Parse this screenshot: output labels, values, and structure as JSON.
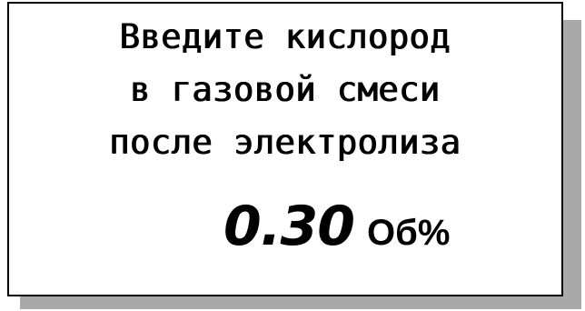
{
  "display": {
    "prompt_lines": [
      "Введите кислород",
      "в газовой смеси",
      "после электролиза"
    ],
    "value": "0.30",
    "unit": "Об%"
  }
}
